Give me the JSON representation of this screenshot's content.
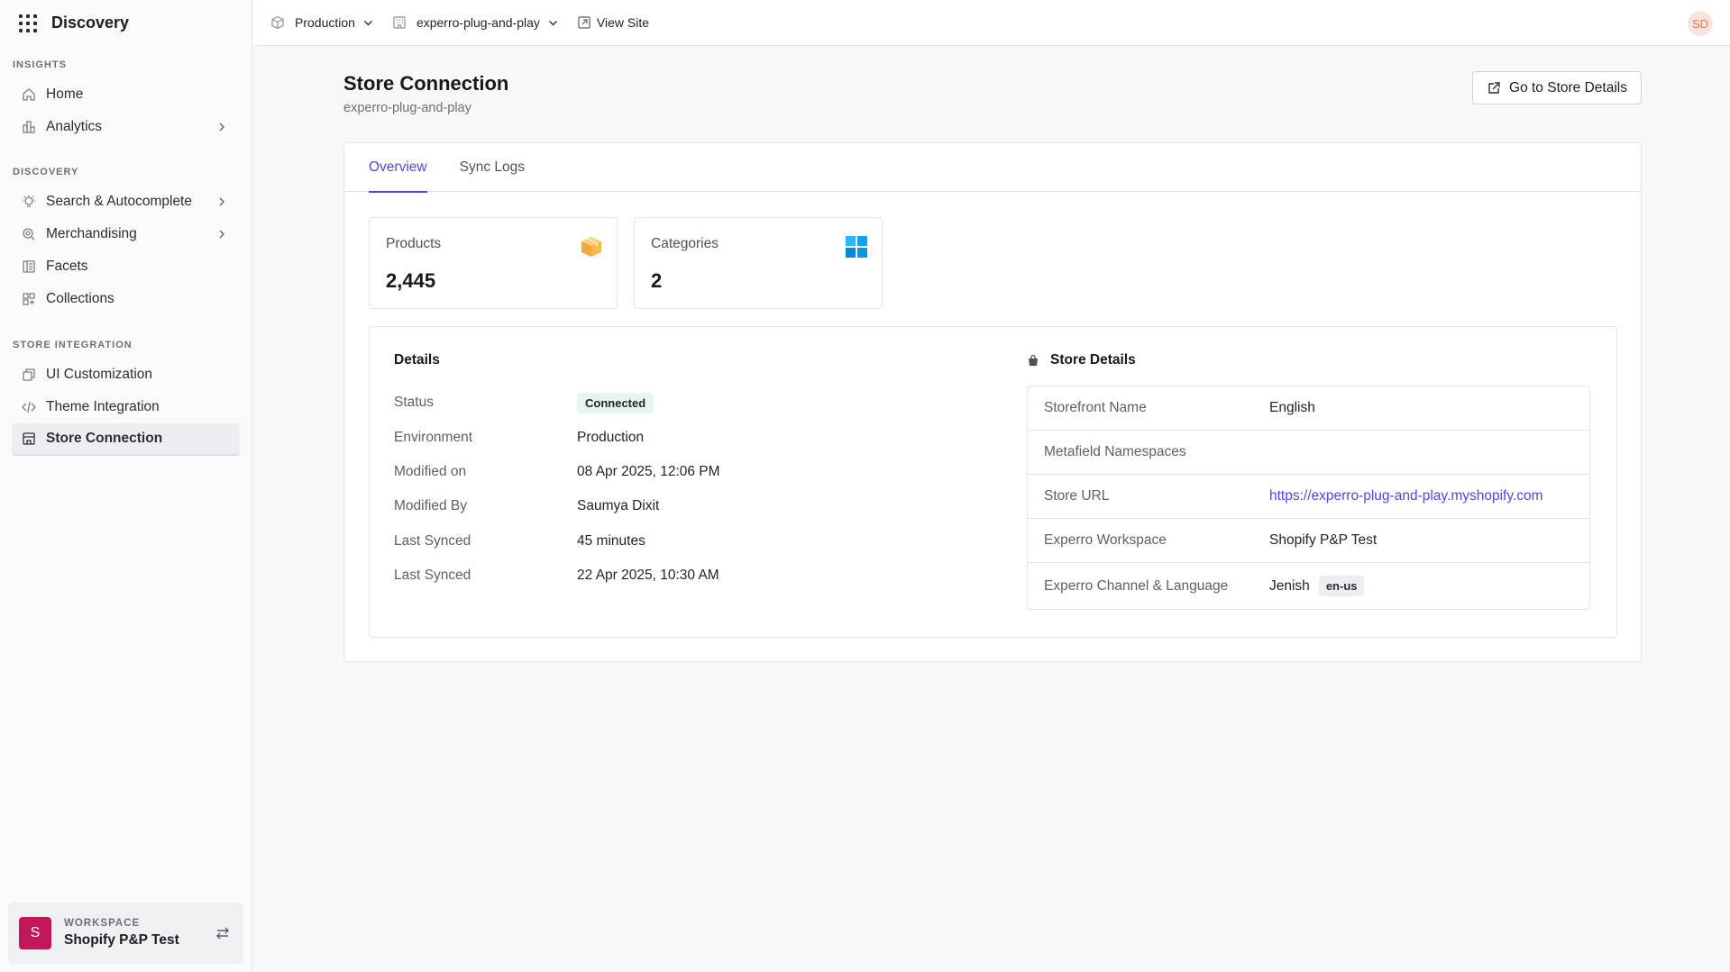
{
  "app": {
    "title": "Discovery"
  },
  "sidebar": {
    "sections": [
      {
        "title": "INSIGHTS",
        "items": [
          {
            "label": "Home",
            "icon": "home-icon"
          },
          {
            "label": "Analytics",
            "icon": "analytics-icon",
            "has_children": true
          }
        ]
      },
      {
        "title": "DISCOVERY",
        "items": [
          {
            "label": "Search & Autocomplete",
            "icon": "bulb-icon",
            "has_children": true
          },
          {
            "label": "Merchandising",
            "icon": "merch-icon",
            "has_children": true
          },
          {
            "label": "Facets",
            "icon": "facets-icon"
          },
          {
            "label": "Collections",
            "icon": "collections-icon"
          }
        ]
      },
      {
        "title": "STORE INTEGRATION",
        "items": [
          {
            "label": "UI Customization",
            "icon": "customize-icon"
          },
          {
            "label": "Theme Integration",
            "icon": "code-icon"
          },
          {
            "label": "Store Connection",
            "icon": "store-icon",
            "active": true
          }
        ]
      }
    ],
    "workspace": {
      "label": "WORKSPACE",
      "name": "Shopify P&P Test",
      "avatar_letter": "S",
      "avatar_color": "#c2185b"
    }
  },
  "topbar": {
    "environment": "Production",
    "site": "experro-plug-and-play",
    "view_site": "View Site",
    "user_initials": "SD"
  },
  "page": {
    "title": "Store Connection",
    "subtitle": "experro-plug-and-play",
    "action_button": "Go to Store Details"
  },
  "tabs": [
    {
      "label": "Overview",
      "active": true
    },
    {
      "label": "Sync Logs",
      "active": false
    }
  ],
  "stats": [
    {
      "label": "Products",
      "value": "2,445",
      "icon": "box-icon"
    },
    {
      "label": "Categories",
      "value": "2",
      "icon": "grid-tiles-icon"
    }
  ],
  "details": {
    "title": "Details",
    "rows": [
      {
        "key": "Status",
        "value": "Connected",
        "badge": true
      },
      {
        "key": "Environment",
        "value": "Production"
      },
      {
        "key": "Modified on",
        "value": "08 Apr 2025, 12:06 PM"
      },
      {
        "key": "Modified By",
        "value": "Saumya Dixit"
      },
      {
        "key": "Last Synced",
        "value": "45 minutes"
      },
      {
        "key": "Last Synced",
        "value": "22 Apr 2025, 10:30 AM"
      }
    ]
  },
  "store_details": {
    "title": "Store Details",
    "rows": [
      {
        "key": "Storefront Name",
        "value": "English"
      },
      {
        "key": "Metafield Namespaces",
        "value": ""
      },
      {
        "key": "Store URL",
        "value": "https://experro-plug-and-play.myshopify.com",
        "link": true
      },
      {
        "key": "Experro Workspace",
        "value": "Shopify P&P Test"
      },
      {
        "key": "Experro Channel & Language",
        "value": "Jenish",
        "chip": "en-us"
      }
    ]
  },
  "colors": {
    "accent": "#4f46e5",
    "connected_bg": "#e6f6ee",
    "connected_text": "#15803d"
  }
}
